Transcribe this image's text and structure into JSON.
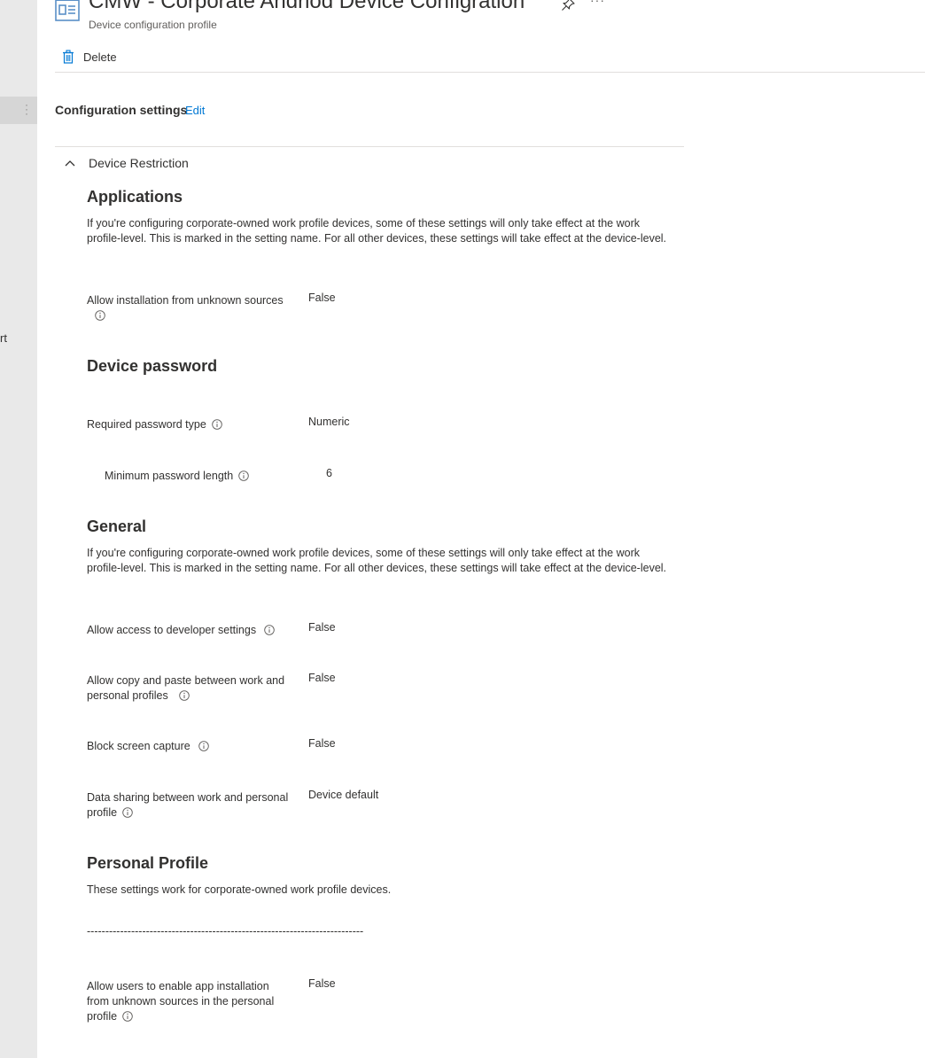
{
  "header": {
    "title": "CMW - Corporate Andriod Device Configration",
    "subtitle": "Device configuration profile",
    "icons": {
      "profile": "profile-icon",
      "pin": "pin-icon",
      "more": "ellipsis-icon"
    },
    "more_label": "···"
  },
  "left_rail": {
    "cut_text": "rt"
  },
  "toolbar": {
    "delete_label": "Delete",
    "delete_icon": "trash-icon"
  },
  "config": {
    "title": "Configuration settings",
    "edit_label": "Edit",
    "group_label": "Device Restriction"
  },
  "sections": {
    "applications": {
      "heading": "Applications",
      "description": "If you're configuring corporate-owned work profile devices, some of these settings will only take effect at the work profile-level. This is marked in the setting name. For all other devices, these settings will take effect at the device-level.",
      "rows": [
        {
          "label": "Allow installation from unknown sources",
          "value": "False"
        }
      ]
    },
    "device_password": {
      "heading": "Device password",
      "rows": [
        {
          "label": "Required password type",
          "value": "Numeric"
        },
        {
          "label": "Minimum password length",
          "value": "6"
        }
      ]
    },
    "general": {
      "heading": "General",
      "description": "If you're configuring corporate-owned work profile devices, some of these settings will only take effect at the work profile-level. This is marked in the setting name. For all other devices, these settings will take effect at the device-level.",
      "rows": [
        {
          "label": "Allow access to developer settings",
          "value": "False"
        },
        {
          "label": "Allow copy and paste between work and personal profiles",
          "value": "False"
        },
        {
          "label": "Block screen capture",
          "value": "False"
        },
        {
          "label": "Data sharing between work and personal profile",
          "value": "Device default"
        }
      ]
    },
    "personal_profile": {
      "heading": "Personal Profile",
      "description": "These settings work for corporate-owned work profile devices.",
      "separator": "---------------------------------------------------------------------------",
      "rows": [
        {
          "label": "Allow users to enable app installation from unknown sources in the personal profile",
          "value": "False"
        }
      ]
    }
  },
  "colors": {
    "accent": "#0078d4",
    "text": "#323130",
    "rail": "#e9e9e9",
    "divider": "#e1dfdd"
  }
}
